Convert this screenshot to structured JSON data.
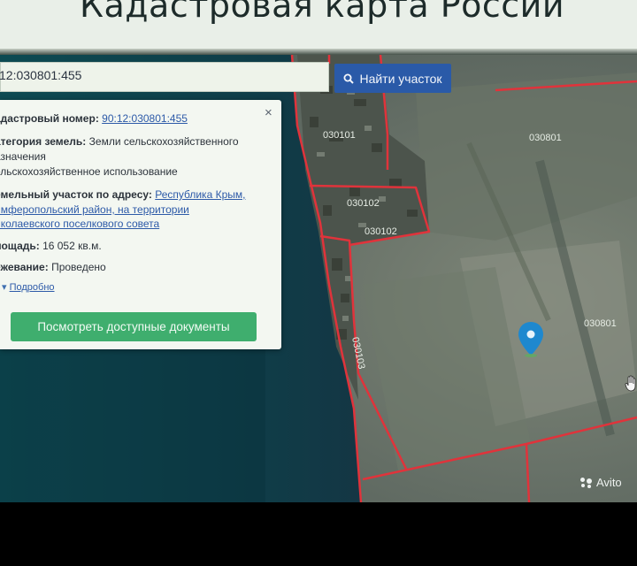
{
  "header": {
    "title": "Кадастровая карта России"
  },
  "search": {
    "value": "12:030801:455",
    "button_label": "Найти участок"
  },
  "card": {
    "cadastral_label": "адастровый номер:",
    "cadastral_value": "90:12:030801:455",
    "category_label": "атегория земель:",
    "category_value_line1": "Земли сельскохозяйственного",
    "category_value_line2": "азначения",
    "category_value_line3": "ельскохозяйственное использование",
    "address_label": "емельный участок по адресу:",
    "address_line1": "Республика Крым,",
    "address_line2": "имферопольский район, на территории",
    "address_line3": "иколаевского поселкового совета",
    "area_label": "лощадь:",
    "area_value": "16 052 кв.м.",
    "survey_label": "ежевание:",
    "survey_value": "Проведено",
    "more_label": "Подробно",
    "docs_button": "Посмотреть доступные документы",
    "close": "×"
  },
  "map": {
    "quarter_labels": [
      "030101",
      "030801",
      "030102",
      "030102",
      "030801",
      "030103"
    ]
  },
  "watermark": "Avito"
}
